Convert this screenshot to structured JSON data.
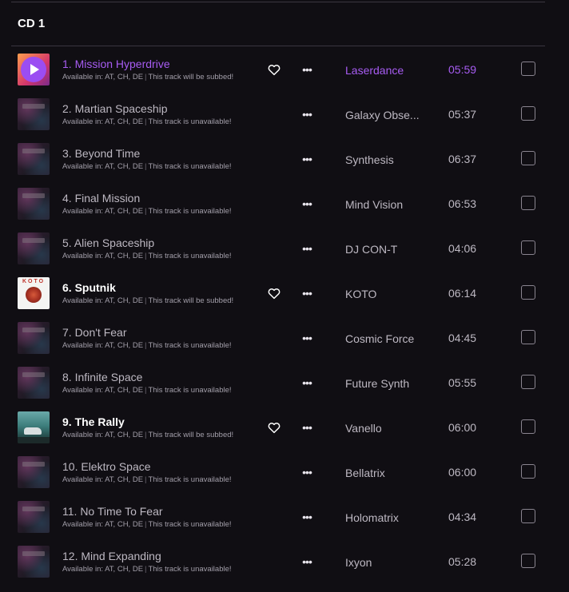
{
  "section": {
    "title": "CD 1"
  },
  "colors": {
    "accent": "#a75cf2",
    "background": "#100e13"
  },
  "icons": {
    "like": "heart-outline-icon",
    "more": "ellipsis-icon",
    "play": "play-icon"
  },
  "tracks": [
    {
      "title": "1. Mission Hyperdrive",
      "availability": "Available in: AT, CH, DE",
      "status": "This track will be subbed!",
      "artist": "Laserdance",
      "duration": "05:59",
      "state": "playing",
      "liked_icon": true,
      "art": "laser"
    },
    {
      "title": "2. Martian Spaceship",
      "availability": "Available in: AT, CH, DE",
      "status": "This track is unavailable!",
      "artist": "Galaxy Obse...",
      "duration": "05:37",
      "state": "unavailable",
      "liked_icon": false,
      "art": "generic"
    },
    {
      "title": "3. Beyond Time",
      "availability": "Available in: AT, CH, DE",
      "status": "This track is unavailable!",
      "artist": "Synthesis",
      "duration": "06:37",
      "state": "unavailable",
      "liked_icon": false,
      "art": "generic"
    },
    {
      "title": "4. Final Mission",
      "availability": "Available in: AT, CH, DE",
      "status": "This track is unavailable!",
      "artist": "Mind Vision",
      "duration": "06:53",
      "state": "unavailable",
      "liked_icon": false,
      "art": "generic"
    },
    {
      "title": "5. Alien Spaceship",
      "availability": "Available in: AT, CH, DE",
      "status": "This track is unavailable!",
      "artist": "DJ CON-T",
      "duration": "04:06",
      "state": "unavailable",
      "liked_icon": false,
      "art": "generic"
    },
    {
      "title": "6. Sputnik",
      "availability": "Available in: AT, CH, DE",
      "status": "This track will be subbed!",
      "artist": "KOTO",
      "duration": "06:14",
      "state": "available",
      "liked_icon": true,
      "art": "koto",
      "art_text": "KOTO"
    },
    {
      "title": "7. Don't Fear",
      "availability": "Available in: AT, CH, DE",
      "status": "This track is unavailable!",
      "artist": "Cosmic Force",
      "duration": "04:45",
      "state": "unavailable",
      "liked_icon": false,
      "art": "generic"
    },
    {
      "title": "8. Infinite Space",
      "availability": "Available in: AT, CH, DE",
      "status": "This track is unavailable!",
      "artist": "Future Synth",
      "duration": "05:55",
      "state": "unavailable",
      "liked_icon": false,
      "art": "generic"
    },
    {
      "title": "9. The Rally",
      "availability": "Available in: AT, CH, DE",
      "status": "This track will be subbed!",
      "artist": "Vanello",
      "duration": "06:00",
      "state": "available",
      "liked_icon": true,
      "art": "rally"
    },
    {
      "title": "10. Elektro Space",
      "availability": "Available in: AT, CH, DE",
      "status": "This track is unavailable!",
      "artist": "Bellatrix",
      "duration": "06:00",
      "state": "unavailable",
      "liked_icon": false,
      "art": "generic"
    },
    {
      "title": "11. No Time To Fear",
      "availability": "Available in: AT, CH, DE",
      "status": "This track is unavailable!",
      "artist": "Holomatrix",
      "duration": "04:34",
      "state": "unavailable",
      "liked_icon": false,
      "art": "generic"
    },
    {
      "title": "12. Mind Expanding",
      "availability": "Available in: AT, CH, DE",
      "status": "This track is unavailable!",
      "artist": "Ixyon",
      "duration": "05:28",
      "state": "unavailable",
      "liked_icon": false,
      "art": "generic"
    }
  ]
}
